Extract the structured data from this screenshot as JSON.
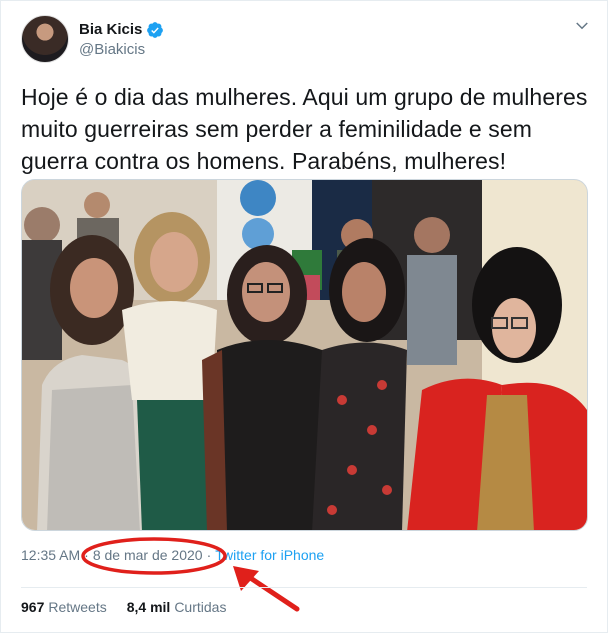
{
  "author": {
    "name": "Bia Kicis",
    "handle": "@Biakicis"
  },
  "tweet": {
    "text": "Hoje é o dia das mulheres. Aqui um grupo de mulheres muito guerreiras sem perder a feminilidade e sem guerra contra os homens. Parabéns, mulheres!"
  },
  "meta": {
    "time": "12:35 AM",
    "separator": "·",
    "date": "8 de mar de 2020",
    "source": "Twitter for iPhone"
  },
  "stats": {
    "retweets_count": "967",
    "retweets_label": "Retweets",
    "likes_count": "8,4 mil",
    "likes_label": "Curtidas"
  },
  "colors": {
    "verified": "#1da1f2",
    "link": "#1da1f2",
    "annotation": "#e0201b"
  },
  "icons": {
    "verified": "verified-badge-icon",
    "menu": "chevron-down-icon"
  }
}
